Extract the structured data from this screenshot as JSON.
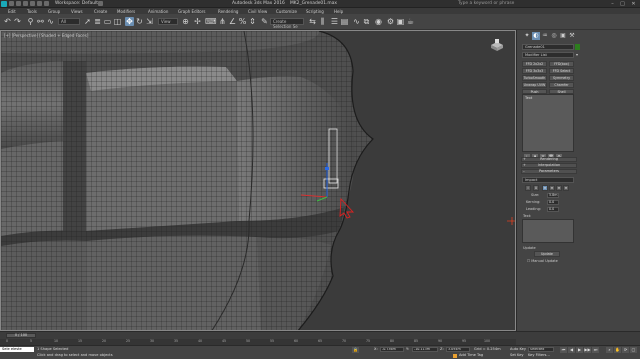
{
  "window": {
    "workspace": "Workspace: Default",
    "app_title": "Autodesk 3ds Max 2016",
    "file_name": "MK2_Grenade01.max",
    "search_placeholder": "Type a keyword or phrase",
    "minimize": "–",
    "maximize": "□",
    "close": "✕"
  },
  "menu": {
    "items": [
      "Edit",
      "Tools",
      "Group",
      "Views",
      "Create",
      "Modifiers",
      "Animation",
      "Graph Editors",
      "Rendering",
      "Civil View",
      "Customize",
      "Scripting",
      "Help"
    ]
  },
  "toolbar": {
    "selection_filter": "All",
    "coord_system": "View",
    "selection_set": "Create Selection Se",
    "icons": [
      "undo-icon",
      "redo-icon",
      "link-icon",
      "unlink-icon",
      "bind-spacewarp-icon",
      "select-icon",
      "select-by-name-icon",
      "rect-selection-icon",
      "window-crossing-icon",
      "move-icon",
      "rotate-icon",
      "scale-icon",
      "pivot-icon",
      "snap-toggle-icon",
      "angle-snap-icon",
      "percent-snap-icon",
      "spinner-snap-icon",
      "mirror-icon",
      "align-icon",
      "layer-icon",
      "curve-editor-icon",
      "schematic-icon",
      "material-editor-icon",
      "render-setup-icon",
      "rendered-frame-icon",
      "render-icon"
    ]
  },
  "viewport": {
    "label": "[+] [Perspective] [Shaded + Edged Faces]",
    "bg_color": "#3b3b3b"
  },
  "command_panel": {
    "tabs": [
      "create-icon",
      "modify-icon",
      "hierarchy-icon",
      "motion-icon",
      "display-icon",
      "utilities-icon"
    ],
    "object_name": "Grenade01",
    "modifier_list": "Modifier List",
    "modifier_buttons": [
      "FFD 2x2x2",
      "FFD(box)",
      "FFD 3x3x3",
      "FFD Select",
      "TurboSmooth",
      "Symmetry",
      "Unwrap UVW",
      "Chamfer",
      "Push",
      "Shell"
    ],
    "stack_item": "Text",
    "rollouts": {
      "rendering": "Rendering",
      "interpolation": "Interpolation",
      "parameters": "Parameters"
    },
    "font": "Impact",
    "size_label": "Size:",
    "size_value": "5.8m",
    "kerning_label": "Kerning:",
    "kerning_value": "0.0",
    "leading_label": "Leading:",
    "leading_value": "0.0",
    "text_label": "Text:",
    "update_label": "Update",
    "update_button": "Update",
    "manual_update_label": "Manual Update",
    "accent_color": "#6b8fb3",
    "object_color": "#2d7d1e"
  },
  "timeline": {
    "slider": "0 / 100",
    "ticks": [
      "0",
      "5",
      "10",
      "15",
      "20",
      "25",
      "30",
      "35",
      "40",
      "45",
      "50",
      "55",
      "60",
      "65",
      "70",
      "75",
      "80",
      "85",
      "90",
      "95",
      "100"
    ]
  },
  "status": {
    "maxscript": "Sele eleste",
    "selection": "1 Shape Selected",
    "prompt": "Click and drag to select and move objects",
    "x_label": "X:",
    "x_value": "-0.736m",
    "y_label": "Y:",
    "y_value": "-10.113m",
    "z_label": "Z:",
    "z_value": "3.094m",
    "grid": "Grid = 0.254m",
    "add_time_tag": "Add Time Tag",
    "auto_key": "Auto Key",
    "set_key": "Set Key",
    "selected_label": "Selected",
    "key_filters": "Key Filters..."
  }
}
